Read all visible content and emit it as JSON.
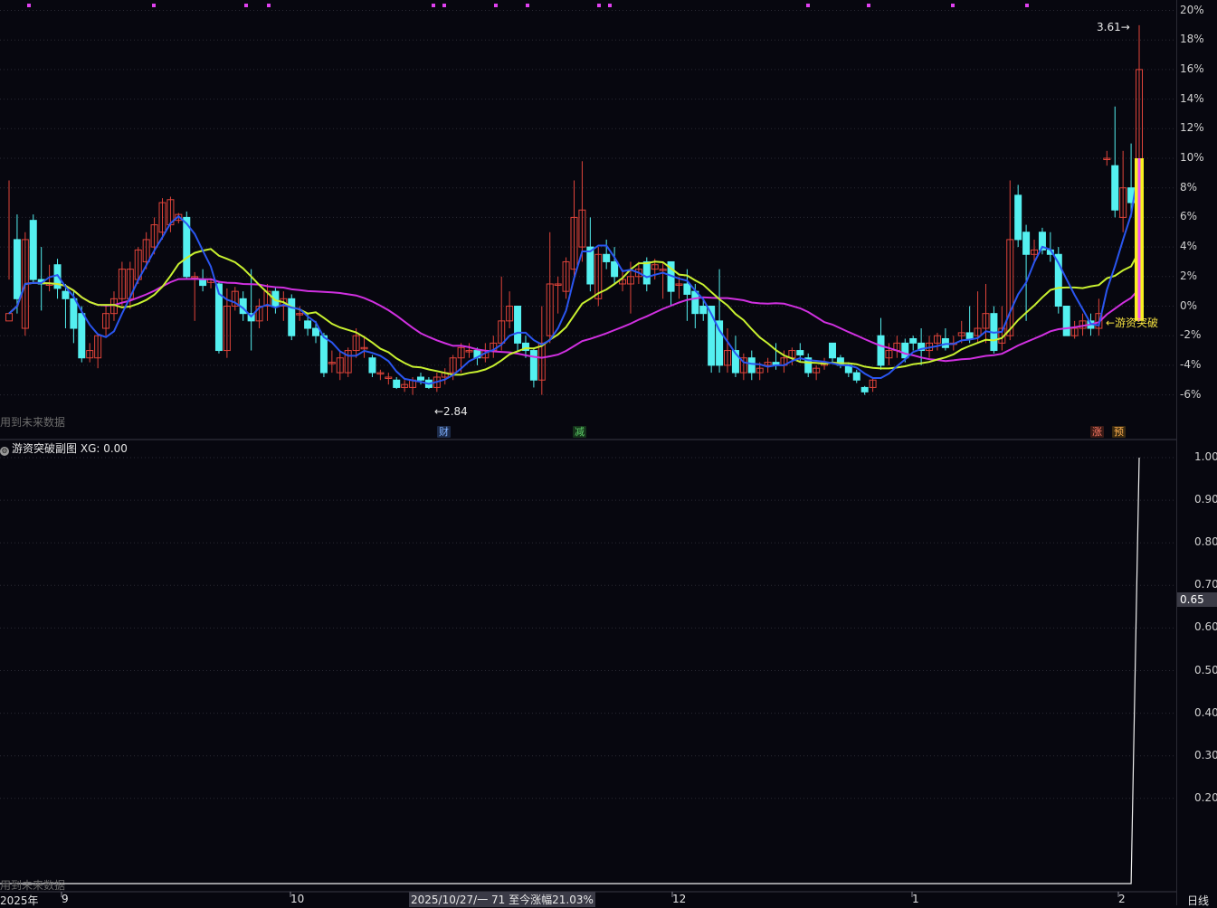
{
  "main_panel": {
    "y_axis_ticks": [
      "20%",
      "18%",
      "16%",
      "14%",
      "12%",
      "10%",
      "8%",
      "6%",
      "4%",
      "2%",
      "0%",
      "-2%",
      "-4%",
      "-6%"
    ],
    "future_data_label": "用到未来数据",
    "low_marker": "←2.84",
    "high_marker": "3.61→",
    "signal_label": "←游资突破",
    "event_badges": [
      {
        "text": "财",
        "color": "#4a8ad0"
      },
      {
        "text": "减",
        "color": "#2f9a3a"
      },
      {
        "text": "涨",
        "color": "#c04a3a"
      },
      {
        "text": "预",
        "color": "#d08a2a"
      }
    ]
  },
  "sub_panel": {
    "title": "游资突破副图",
    "value_label": "XG: 0.00",
    "y_axis_ticks": [
      "1.00",
      "0.90",
      "0.80",
      "0.70",
      "0.60",
      "0.50",
      "0.40",
      "0.30",
      "0.20"
    ],
    "current_value": "0.65",
    "future_data_label": "用到未来数据"
  },
  "x_axis": {
    "labels": [
      "2025年",
      "9",
      "10",
      "12",
      "1",
      "2"
    ],
    "status_text": "2025/10/27/一 71 至今涨幅21.03%",
    "period": "日线"
  },
  "colors": {
    "up": "#e0443a",
    "down": "#54f0f0",
    "ma5": "#2a56f0",
    "ma10": "#c8f030",
    "ma20": "#d030e0",
    "signal_bar": "#f8f020",
    "signal_bar_inner": "#f050f0",
    "grid": "#2a2a34",
    "marker": "#e8e8e8"
  },
  "chart_data": {
    "type": "candlestick",
    "ylabel": "",
    "ylim": [
      -7,
      20
    ],
    "ticks_percent": [
      20,
      18,
      16,
      14,
      12,
      10,
      8,
      6,
      4,
      2,
      0,
      -2,
      -4,
      -6
    ],
    "candles": [
      [
        -1,
        -0.5,
        1.8,
        8.5
      ],
      [
        4.5,
        0.5,
        -0.5,
        6.2
      ],
      [
        -1.5,
        4.5,
        -2,
        5
      ],
      [
        5.8,
        1.8,
        1.5,
        6.2
      ],
      [
        1.8,
        1.5,
        -0.3,
        4
      ],
      [
        1.5,
        1.5,
        1,
        2.8
      ],
      [
        2.8,
        1.2,
        0.5,
        3.2
      ],
      [
        1,
        0.5,
        -1.5,
        1.5
      ],
      [
        0.5,
        -1.5,
        -2.5,
        1
      ],
      [
        -0.5,
        -3.5,
        -3.8,
        0
      ],
      [
        -3.5,
        -3,
        -3.8,
        -2.5
      ],
      [
        -3.5,
        -2,
        -4.2,
        -2
      ],
      [
        -1.5,
        -0.5,
        -2,
        0
      ],
      [
        -0.5,
        0.5,
        -1,
        1
      ],
      [
        0.5,
        2.5,
        0,
        3
      ],
      [
        0.5,
        2.5,
        -0.2,
        3
      ],
      [
        1.8,
        3.8,
        1.5,
        4
      ],
      [
        3,
        4.5,
        2.5,
        5
      ],
      [
        4,
        5.5,
        3.5,
        6
      ],
      [
        5,
        7,
        4.5,
        7.3
      ],
      [
        5.5,
        7.2,
        5,
        7.4
      ],
      [
        5.8,
        6.2,
        5.6,
        6.3
      ],
      [
        6,
        2,
        1.8,
        6.4
      ],
      [
        2,
        2,
        -1,
        2.3
      ],
      [
        1.8,
        1.4,
        1,
        2.5
      ],
      [
        1.6,
        1.8,
        1.2,
        1.9
      ],
      [
        1.5,
        -3,
        -3.2,
        1.7
      ],
      [
        -3,
        0,
        -3.5,
        1.2
      ],
      [
        0,
        1,
        -0.3,
        1.3
      ],
      [
        0.5,
        -0.5,
        -1,
        1
      ],
      [
        -0.5,
        -1,
        -3,
        2.5
      ],
      [
        -1,
        0,
        -1.5,
        0.5
      ],
      [
        0,
        1,
        -1,
        1.5
      ],
      [
        1,
        0,
        -0.5,
        1.3
      ],
      [
        0,
        0.5,
        -1,
        1
      ],
      [
        0.5,
        -2,
        -2.3,
        0.8
      ],
      [
        -0.5,
        -0.5,
        -1,
        0
      ],
      [
        -1,
        -1.5,
        -2,
        -0.5
      ],
      [
        -1.5,
        -2,
        -2.5,
        -1
      ],
      [
        -2,
        -4.5,
        -4.8,
        -1.8
      ],
      [
        -3.8,
        -3.8,
        -4.5,
        -3
      ],
      [
        -4.5,
        -3.5,
        -5,
        -3
      ],
      [
        -4.5,
        -3,
        -4.8,
        -2.8
      ],
      [
        -3,
        -2,
        -3.5,
        -1.5
      ],
      [
        -2.8,
        -2.8,
        -3.5,
        -2
      ],
      [
        -3.5,
        -4.5,
        -4.8,
        -3.3
      ],
      [
        -4.5,
        -4.5,
        -5,
        -4.3
      ],
      [
        -4.8,
        -4.8,
        -5.3,
        -4.5
      ],
      [
        -5,
        -5.5,
        -5.6,
        -4.8
      ],
      [
        -5.5,
        -5.3,
        -5.8,
        -5
      ],
      [
        -5.5,
        -5,
        -6,
        -4.8
      ],
      [
        -4.8,
        -5,
        -5.3,
        -4.5
      ],
      [
        -5,
        -5.5,
        -5.6,
        -4.8
      ],
      [
        -5.5,
        -4.8,
        -5.8,
        -4.5
      ],
      [
        -4.8,
        -4.5,
        -5.3,
        -4.2
      ],
      [
        -4.5,
        -3.5,
        -5,
        -3.3
      ],
      [
        -3.5,
        -2.8,
        -4.5,
        -2.5
      ],
      [
        -3,
        -3,
        -3.5,
        -2.5
      ],
      [
        -3,
        -3.5,
        -4,
        -2.8
      ],
      [
        -3.5,
        -3,
        -3.8,
        -2.5
      ],
      [
        -3,
        -2.5,
        -3.5,
        -2
      ],
      [
        -2.5,
        -1,
        -3,
        2
      ],
      [
        -1,
        0,
        -1.5,
        1
      ],
      [
        0,
        -2.5,
        -3,
        0
      ],
      [
        -2.5,
        -3,
        -3.5,
        -2
      ],
      [
        -3,
        -5,
        -5.5,
        -2.8
      ],
      [
        -5,
        -2.5,
        -6,
        0
      ],
      [
        -2,
        1.5,
        -2.5,
        5
      ],
      [
        1.5,
        1.5,
        -0.5,
        2
      ],
      [
        1,
        3,
        0.5,
        3.3
      ],
      [
        2.5,
        6,
        2,
        8.5
      ],
      [
        4,
        6.5,
        3,
        9.8
      ],
      [
        4,
        1.5,
        1,
        6
      ],
      [
        0.5,
        3.5,
        0,
        4
      ],
      [
        3.5,
        3,
        2.5,
        4.5
      ],
      [
        3,
        2,
        1.5,
        4
      ],
      [
        1.5,
        1.8,
        1,
        2.5
      ],
      [
        1.5,
        2,
        -0.5,
        3
      ],
      [
        2,
        2.5,
        1.5,
        3
      ],
      [
        3,
        1.5,
        1,
        3.3
      ],
      [
        2.5,
        2.8,
        1.8,
        3.2
      ],
      [
        2.5,
        2.5,
        0.5,
        3
      ],
      [
        3,
        1,
        0,
        3
      ],
      [
        1.5,
        1.5,
        0.5,
        2
      ],
      [
        1.5,
        0.8,
        -1,
        2.5
      ],
      [
        1,
        -0.5,
        -1.5,
        1.5
      ],
      [
        0,
        -0.5,
        -1,
        0.5
      ],
      [
        0,
        -4,
        -4.5,
        0
      ],
      [
        -1,
        -4,
        -4.5,
        2.5
      ],
      [
        -4,
        -3,
        -4.5,
        -1.5
      ],
      [
        -3,
        -4.5,
        -4.8,
        -2
      ],
      [
        -4.5,
        -3.5,
        -5,
        -3.2
      ],
      [
        -3.5,
        -4.5,
        -5,
        -3
      ],
      [
        -4.5,
        -4.2,
        -5,
        -3.8
      ],
      [
        -4,
        -3.8,
        -4.5,
        -3.5
      ],
      [
        -3.8,
        -4,
        -4.3,
        -2.5
      ],
      [
        -4,
        -3.5,
        -4.5,
        -3
      ],
      [
        -3.5,
        -3,
        -4,
        -2.8
      ],
      [
        -3,
        -3.3,
        -3.8,
        -2.5
      ],
      [
        -3.5,
        -4.5,
        -4.8,
        -3.2
      ],
      [
        -4.5,
        -4.2,
        -5,
        -4
      ],
      [
        -4,
        -3.8,
        -4.3,
        -3.5
      ],
      [
        -2.5,
        -3.5,
        -3.8,
        -2.5
      ],
      [
        -3.5,
        -4,
        -4.2,
        -3.3
      ],
      [
        -4,
        -4.5,
        -4.8,
        -3.8
      ],
      [
        -4.5,
        -5,
        -5.2,
        -4.3
      ],
      [
        -5.5,
        -5.8,
        -6,
        -5.4
      ],
      [
        -5.5,
        -5,
        -5.8,
        -4.8
      ],
      [
        -2,
        -4,
        -4.3,
        -0.8
      ],
      [
        -3.5,
        -3,
        -4,
        -2.5
      ],
      [
        -3,
        -2.5,
        -3.5,
        -2
      ],
      [
        -2.5,
        -3.5,
        -3.8,
        -2.2
      ],
      [
        -2.2,
        -2.5,
        -3,
        -2
      ],
      [
        -2.5,
        -3,
        -4,
        -1.5
      ],
      [
        -3,
        -2.5,
        -3.5,
        -2
      ],
      [
        -2.5,
        -2,
        -3,
        -1.8
      ],
      [
        -2.2,
        -2.8,
        -3,
        -1.5
      ],
      [
        -2.5,
        -2.5,
        -3,
        -2
      ],
      [
        -2,
        -1.8,
        -2.5,
        -1
      ],
      [
        -1.8,
        -2.2,
        -2.5,
        0
      ],
      [
        -2,
        -1.5,
        -2.5,
        1
      ],
      [
        -1.5,
        -0.5,
        -2.5,
        1.5
      ],
      [
        -0.5,
        -3,
        -3.2,
        0
      ],
      [
        -2.5,
        -1.5,
        -3,
        0
      ],
      [
        -2,
        4.5,
        -2.3,
        8.5
      ],
      [
        7.5,
        4.5,
        4,
        8.2
      ],
      [
        5,
        3.5,
        -1,
        5.5
      ],
      [
        3.5,
        3.8,
        3,
        4.5
      ],
      [
        5,
        3.8,
        3.5,
        5.3
      ],
      [
        3.8,
        3.5,
        3,
        5
      ],
      [
        3.5,
        0,
        -0.5,
        4
      ],
      [
        0,
        -2,
        -2,
        0
      ],
      [
        -2,
        -1.5,
        -2.2,
        -1
      ],
      [
        -1.5,
        -1,
        -2,
        -0.5
      ],
      [
        -1,
        -1.5,
        -2,
        -0.5
      ],
      [
        -1.5,
        -0.5,
        -2,
        0.5
      ],
      [
        10,
        10,
        9.5,
        10.5
      ],
      [
        9.5,
        6.5,
        6,
        13.5
      ],
      [
        6,
        8,
        5,
        10.5
      ],
      [
        8,
        7,
        6,
        11
      ],
      [
        7.5,
        16,
        7,
        19
      ]
    ]
  }
}
